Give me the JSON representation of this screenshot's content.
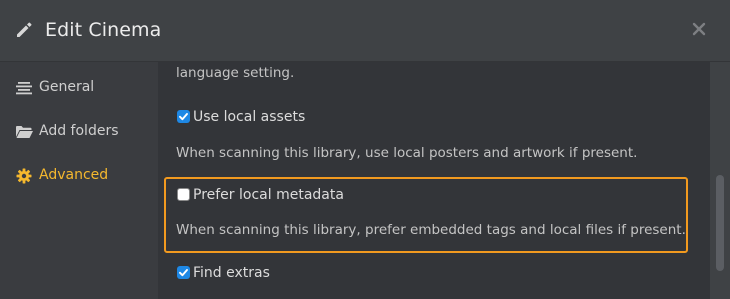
{
  "dialog": {
    "title": "Edit Cinema",
    "close_icon": "close-icon",
    "edit_icon": "pencil-icon"
  },
  "sidebar": {
    "items": [
      {
        "label": "General",
        "icon": "list-icon",
        "active": false
      },
      {
        "label": "Add folders",
        "icon": "folder-icon",
        "active": false
      },
      {
        "label": "Advanced",
        "icon": "gear-icon",
        "active": true
      }
    ]
  },
  "content": {
    "partial_text": "language setting.",
    "options": [
      {
        "label": "Use local assets",
        "checked": true,
        "description": "When scanning this library, use local posters and artwork if present."
      },
      {
        "label": "Prefer local metadata",
        "checked": false,
        "description": "When scanning this library, prefer embedded tags and local files if present."
      },
      {
        "label": "Find extras",
        "checked": true
      }
    ]
  },
  "colors": {
    "accent": "#f5b82e",
    "highlight_border": "#f29a1f",
    "checkbox_checked": "#1e88e5"
  }
}
